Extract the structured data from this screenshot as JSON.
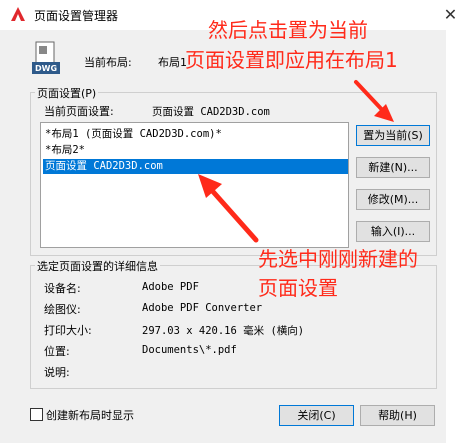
{
  "window": {
    "title": "页面设置管理器",
    "close_glyph": "✕"
  },
  "current_layout": {
    "label": "当前布局:",
    "value": "布局1"
  },
  "page_setup_group": {
    "title": "页面设置(P)",
    "current_label": "当前页面设置:",
    "current_value": "页面设置 CAD2D3D.com",
    "list": [
      "*布局1 (页面设置 CAD2D3D.com)*",
      "*布局2*",
      "页面设置 CAD2D3D.com"
    ],
    "selected_index": 2
  },
  "buttons": {
    "set_current": "置为当前(S)",
    "new": "新建(N)...",
    "modify": "修改(M)...",
    "import": "输入(I)...",
    "close": "关闭(C)",
    "help": "帮助(H)"
  },
  "details": {
    "title": "选定页面设置的详细信息",
    "device_label": "设备名:",
    "device_value": "Adobe PDF",
    "plotter_label": "绘图仪:",
    "plotter_value": "Adobe PDF Converter",
    "size_label": "打印大小:",
    "size_value": "297.03 x 420.16 毫米 (横向)",
    "location_label": "位置:",
    "location_value": "Documents\\*.pdf",
    "desc_label": "说明:"
  },
  "checkbox": {
    "label": "创建新布局时显示"
  },
  "annotations": {
    "top_line1": "然后点击置为当前",
    "top_line2": "页面设置即应用在布局1",
    "bottom_line1": "先选中刚刚新建的",
    "bottom_line2": "页面设置"
  },
  "colors": {
    "annotation": "#ff2a1a",
    "selection": "#0078d7"
  }
}
